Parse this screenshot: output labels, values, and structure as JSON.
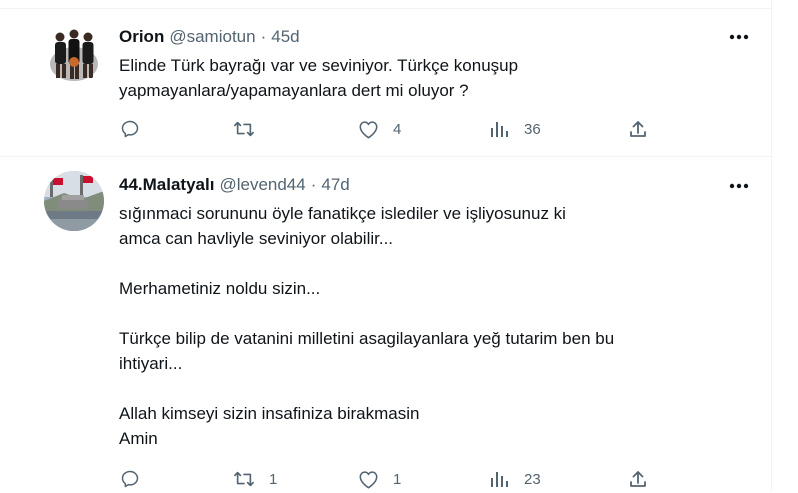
{
  "tweets": [
    {
      "display_name": "Orion",
      "handle": "@samiotun",
      "separator": "·",
      "time": "45d",
      "lines": [
        "Elinde Türk bayrağı var ve seviniyor. Türkçe konuşup",
        "yapmayanlara/yapamayanlara dert mi oluyor ?"
      ],
      "actions": {
        "replies": "",
        "retweets": "",
        "likes": "4",
        "views": "36"
      }
    },
    {
      "display_name": "44.Malatyalı",
      "handle": "@levend44",
      "separator": "·",
      "time": "47d",
      "lines": [
        "sığınmaci sorununu öyle fanatikçe islediler ve işliyosunuz ki",
        "amca can havliyle seviniyor olabilir...",
        "",
        "Merhametiniz noldu sizin...",
        "",
        "Türkçe bilip de vatanini milletini asagilayanlara yeğ tutarim ben bu",
        "ihtiyari...",
        "",
        "Allah kimseyi sizin insafiniza birakmasin",
        "Amin"
      ],
      "actions": {
        "replies": "",
        "retweets": "1",
        "likes": "1",
        "views": "23"
      }
    }
  ],
  "colors": {
    "text": "#0f1419",
    "secondary": "#536471",
    "divider": "#eff3f4"
  },
  "icons": {
    "more": "more-horizontal-icon",
    "reply": "reply-icon",
    "retweet": "retweet-icon",
    "like": "heart-icon",
    "views": "views-icon",
    "share": "share-icon"
  }
}
